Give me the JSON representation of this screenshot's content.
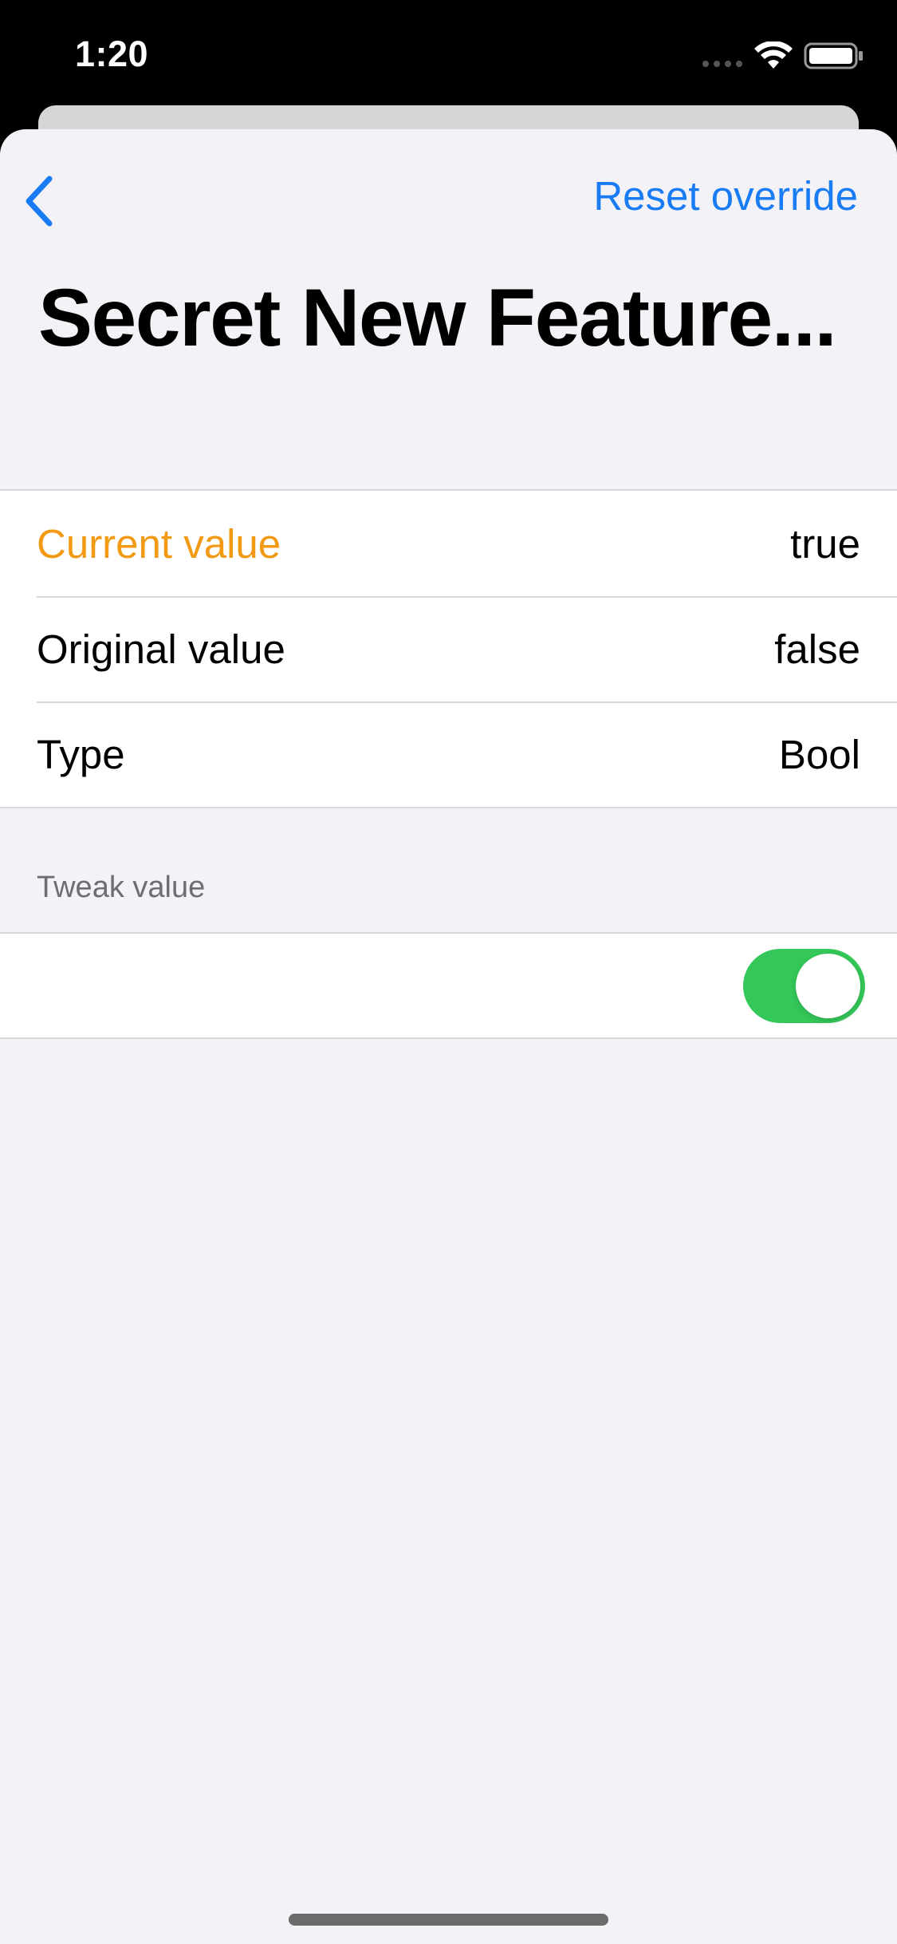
{
  "status_bar": {
    "time": "1:20",
    "icons": [
      "cellular-signal-icon",
      "wifi-icon",
      "battery-icon"
    ]
  },
  "nav": {
    "back_icon": "chevron-left-icon",
    "reset_label": "Reset override"
  },
  "title": "Secret New Feature...",
  "info_rows": [
    {
      "label": "Current value",
      "value": "true"
    },
    {
      "label": "Original value",
      "value": "false"
    },
    {
      "label": "Type",
      "value": "Bool"
    }
  ],
  "tweak_section": {
    "header": "Tweak value",
    "toggle_on": true
  },
  "colors": {
    "accent": "#1a7cf5",
    "highlight": "#f39a14",
    "toggle_on": "#34c759",
    "background": "#f2f2f7"
  }
}
